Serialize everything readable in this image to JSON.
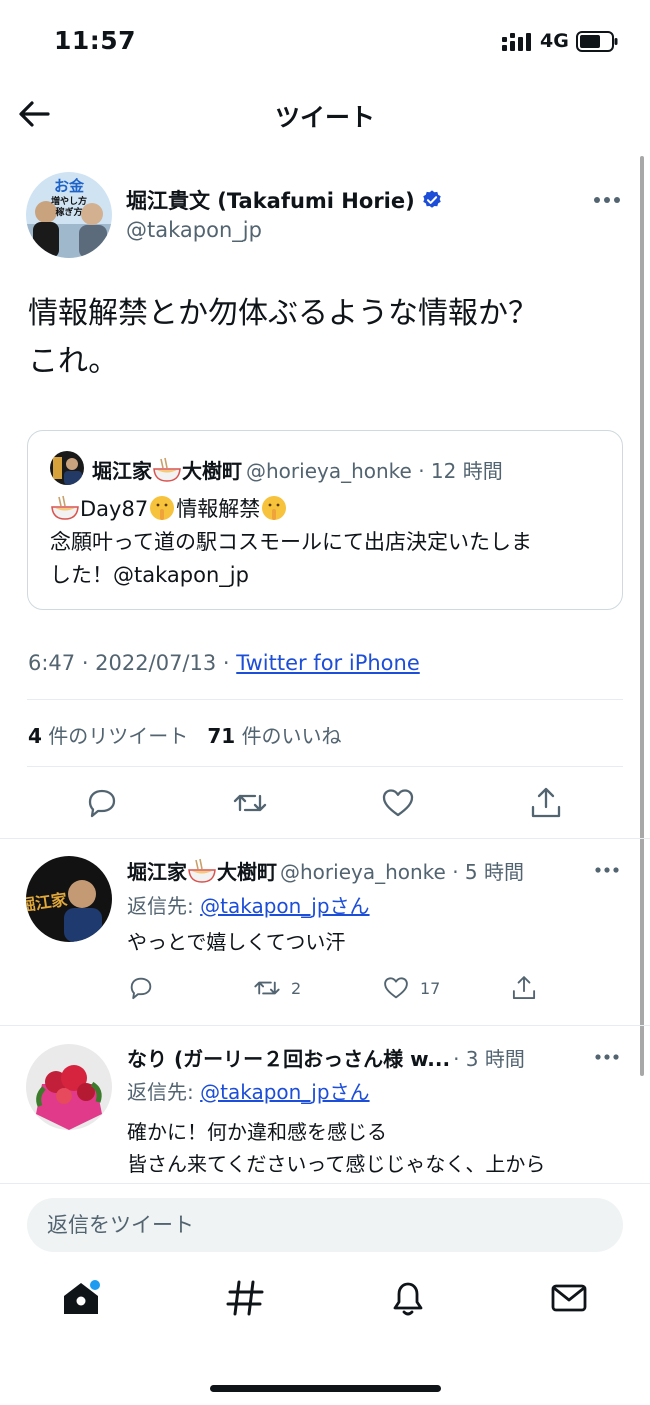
{
  "status_bar": {
    "time": "11:57",
    "network": "4G"
  },
  "nav": {
    "title": "ツイート"
  },
  "tweet": {
    "author_name": "堀江貴文 (Takafumi Horie)",
    "author_handle": "@takapon_jp",
    "text_line1": "情報解禁とか勿体ぶるような情報か？",
    "text_line2": "これ。",
    "meta_time": "6:47 · 2022/07/13 · ",
    "meta_source": "Twitter for iPhone",
    "retweet_count": "4",
    "retweet_label": "件のリツイート",
    "like_count": "71",
    "like_label": "件のいいね"
  },
  "quote": {
    "name_prefix": "堀江家",
    "name_suffix": "大樹町",
    "handle_time": "@horieya_honke · 12 時間",
    "line1_day": "Day87",
    "line1_text": "情報解禁",
    "line2": "念願叶って道の駅コスモールにて出店決定いたしま",
    "line3": "した！@takapon_jp"
  },
  "replies": [
    {
      "name_prefix": "堀江家",
      "name_suffix": "大樹町",
      "handle_time": "@horieya_honke · 5 時間",
      "reply_to_label": "返信先: ",
      "reply_to_link": "@takapon_jpさん",
      "text_line1": "やっとで嬉しくてつい汗",
      "text_line2": "",
      "retweets": "2",
      "likes": "17"
    },
    {
      "name_prefix": "なり (ガーリー２回おっさん様 w...",
      "name_suffix": "",
      "handle_time": "· 3 時間",
      "reply_to_label": "返信先: ",
      "reply_to_link": "@takapon_jpさん",
      "text_line1": "確かに！何か違和感を感じる",
      "text_line2": "皆さん来てくださいって感じじゃなく、上から"
    }
  ],
  "compose": {
    "placeholder": "返信をツイート"
  },
  "avatar_text": {
    "okane": "お金",
    "fuyashi": "増やし方",
    "kasegi": "稼ぎ方",
    "horie": "堀江家"
  },
  "colors": {
    "link": "#1d4ed8",
    "verified": "#1d9bf0",
    "muted": "#536471"
  },
  "icons": [
    "back-arrow-icon",
    "verified-icon",
    "more-icon",
    "reply-icon",
    "retweet-icon",
    "like-icon",
    "share-icon",
    "home-icon",
    "hashtag-icon",
    "bell-icon",
    "mail-icon"
  ]
}
